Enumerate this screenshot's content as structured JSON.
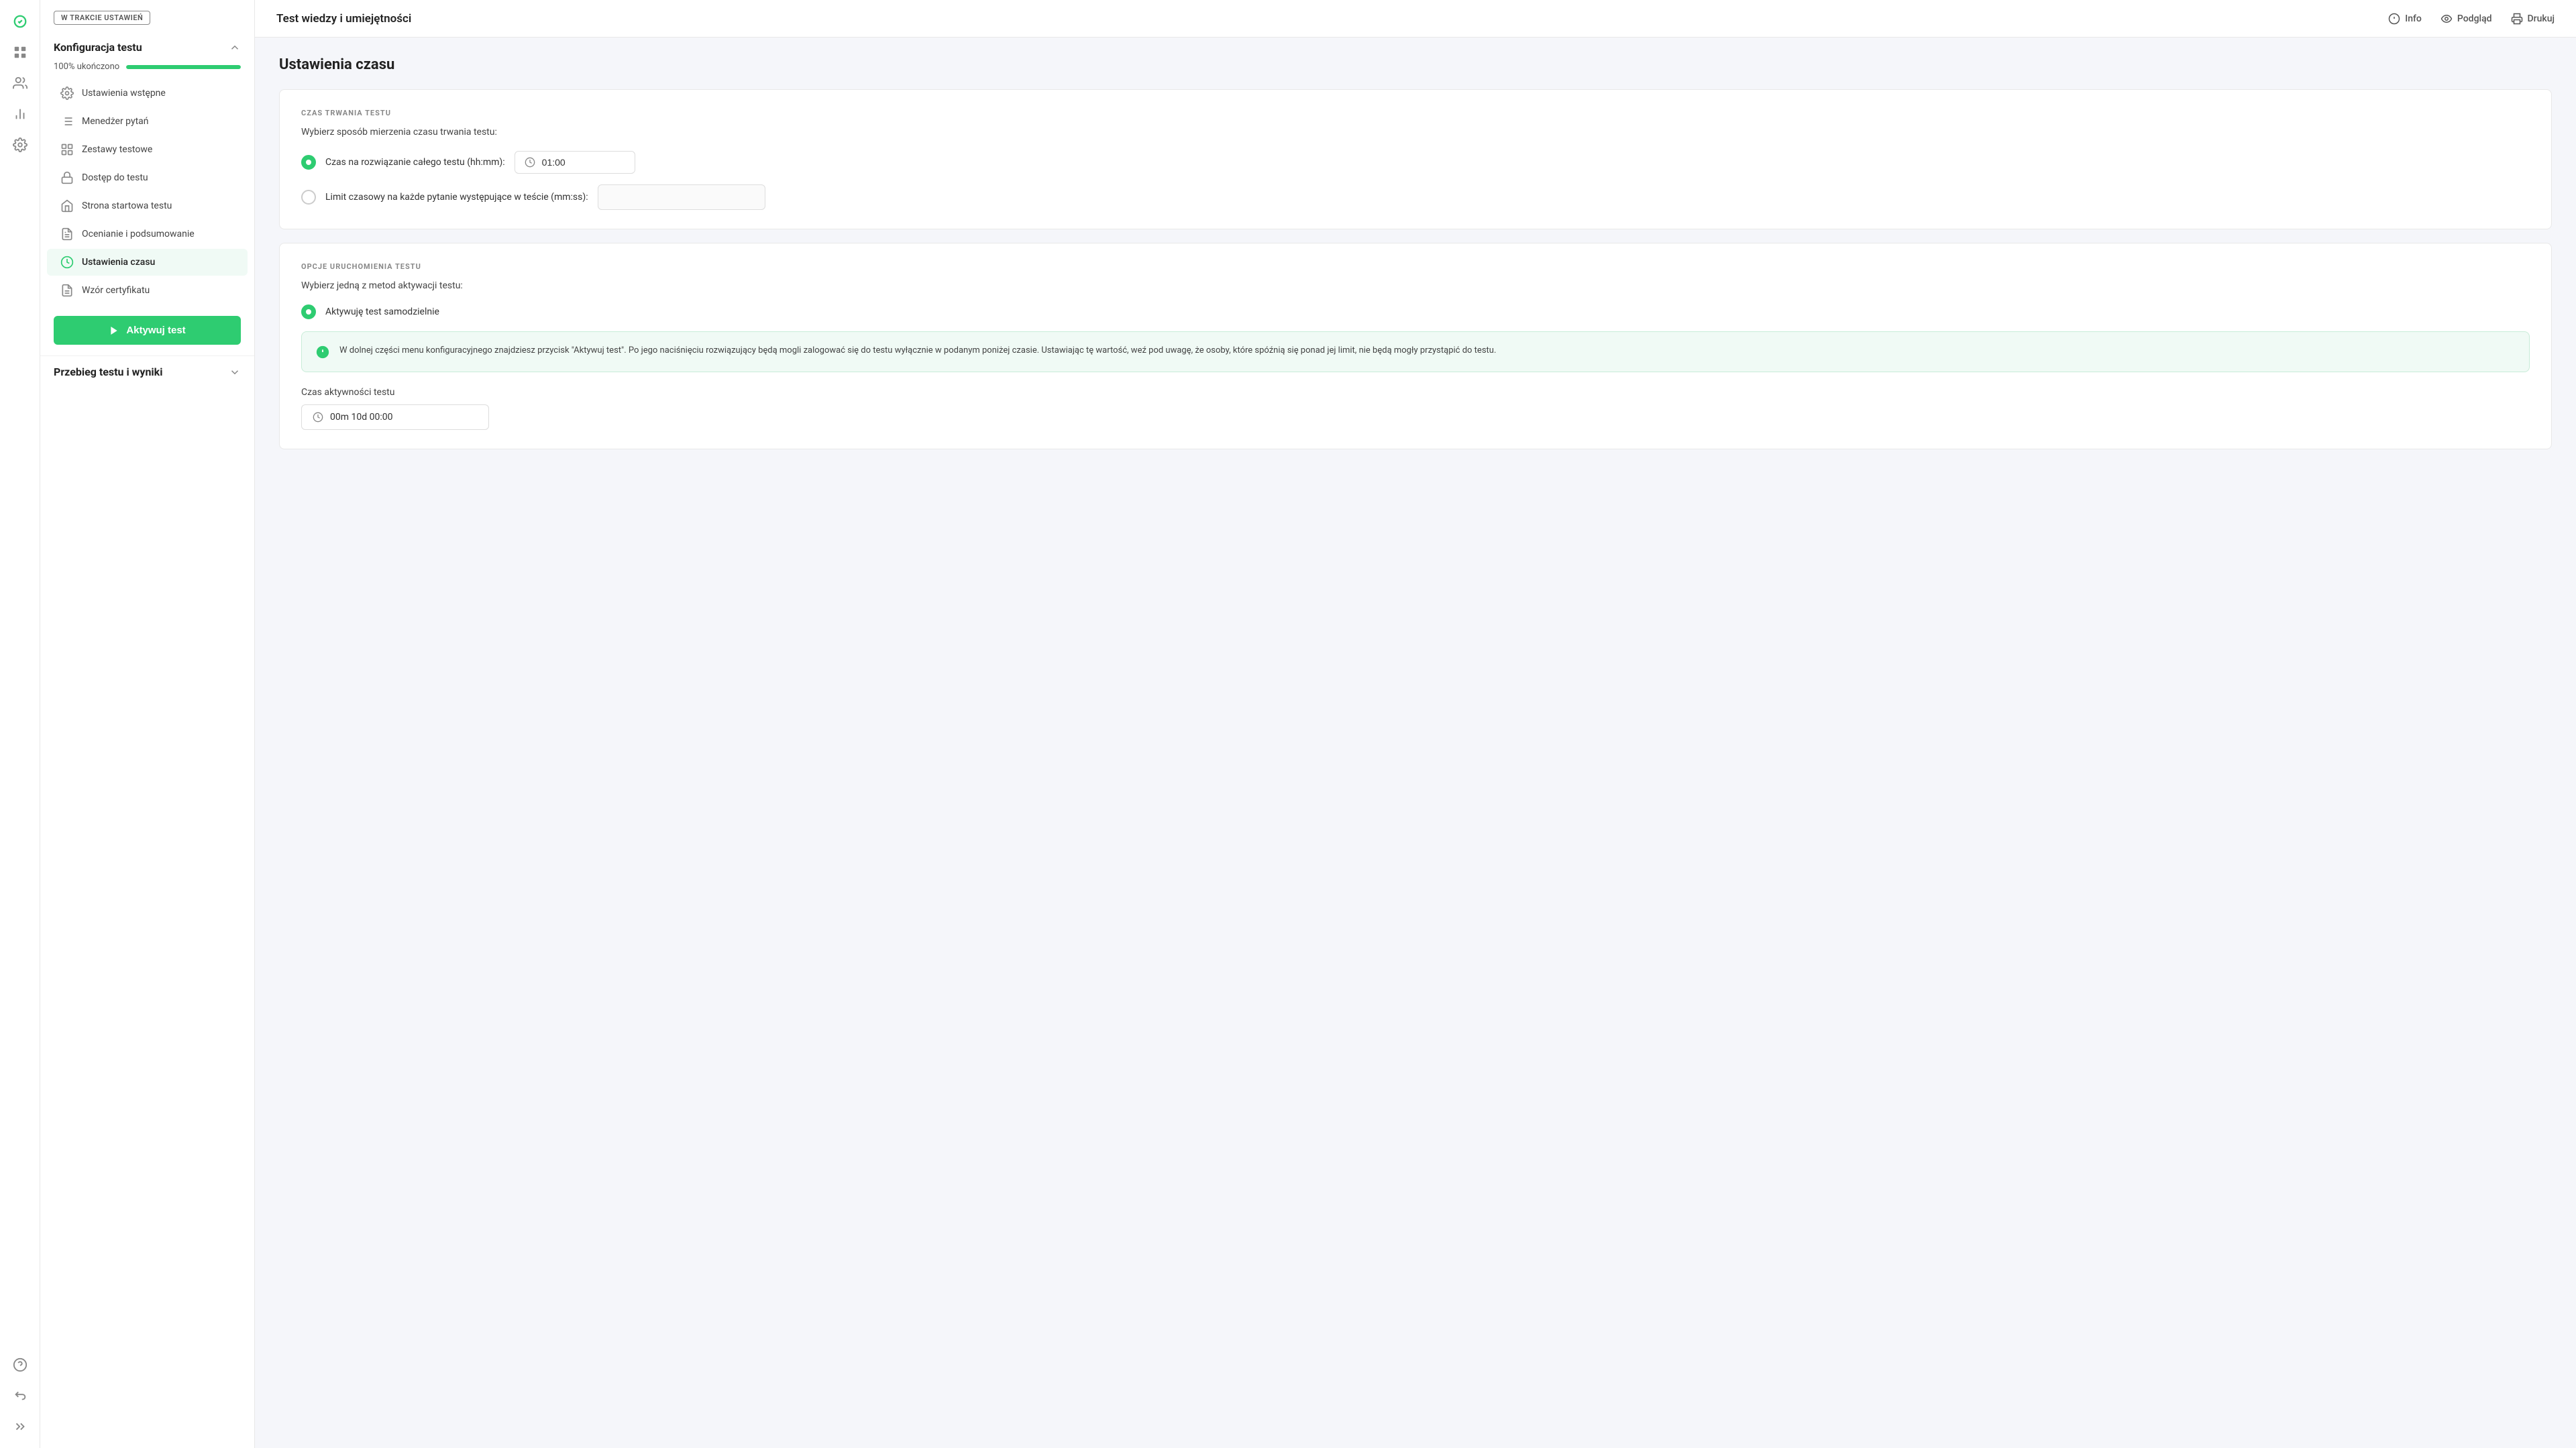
{
  "app": {
    "title": "Test wiedzy i umiejętności"
  },
  "topbar": {
    "info_label": "Info",
    "preview_label": "Podgląd",
    "print_label": "Drukuj"
  },
  "sidebar": {
    "status_badge": "W TRAKCIE USTAWIEŃ",
    "config_section": {
      "title": "Konfiguracja testu",
      "progress_label": "100% ukończono",
      "progress_percent": 100
    },
    "nav_items": [
      {
        "id": "ustawienia-wstepne",
        "label": "Ustawienia wstępne",
        "icon": "settings-icon"
      },
      {
        "id": "menedzer-pytan",
        "label": "Menedżer pytań",
        "icon": "questions-icon"
      },
      {
        "id": "zestawy-testowe",
        "label": "Zestawy testowe",
        "icon": "sets-icon"
      },
      {
        "id": "dostep-do-testu",
        "label": "Dostęp do testu",
        "icon": "lock-icon"
      },
      {
        "id": "strona-startowa",
        "label": "Strona startowa testu",
        "icon": "home-icon"
      },
      {
        "id": "ocenianie",
        "label": "Ocenianie i podsumowanie",
        "icon": "grading-icon"
      },
      {
        "id": "ustawienia-czasu",
        "label": "Ustawienia czasu",
        "icon": "clock-icon",
        "active": true
      },
      {
        "id": "wzor-certyfikatu",
        "label": "Wzór certyfikatu",
        "icon": "certificate-icon"
      }
    ],
    "activate_button": "Aktywuj test",
    "results_section": {
      "title": "Przebieg testu i wyniki"
    }
  },
  "page": {
    "title": "Ustawienia czasu",
    "czas_section": {
      "section_label": "CZAS TRWANIA TESTU",
      "description": "Wybierz sposób mierzenia czasu trwania testu:",
      "option1_label": "Czas na rozwiązanie całego testu (hh:mm):",
      "option1_checked": true,
      "option1_value": "01:00",
      "option2_label": "Limit czasowy na każde pytanie występujące w teście (mm:ss):",
      "option2_checked": false
    },
    "opcje_section": {
      "section_label": "OPCJE URUCHOMIENIA TESTU",
      "description": "Wybierz jedną z metod aktywacji testu:",
      "option1_label": "Aktywuję test samodzielnie",
      "option1_checked": true,
      "info_text": "W dolnej części menu konfiguracyjnego znajdziesz przycisk \"Aktywuj test\". Po jego naciśnięciu rozwiązujący będą mogli zalogować się do testu wyłącznie w podanym poniżej czasie. Ustawiając tę wartość, weź pod uwagę, że osoby, które spóźnią się ponad jej limit, nie będą mogły przystąpić do testu.",
      "activity_label": "Czas aktywności testu",
      "activity_value": "00m 10d 00:00"
    }
  },
  "icons": {
    "check": "✓",
    "info": "ℹ",
    "clock": "⏱",
    "play": "▶",
    "chevron_up": "▲",
    "chevron_down": "▼"
  }
}
